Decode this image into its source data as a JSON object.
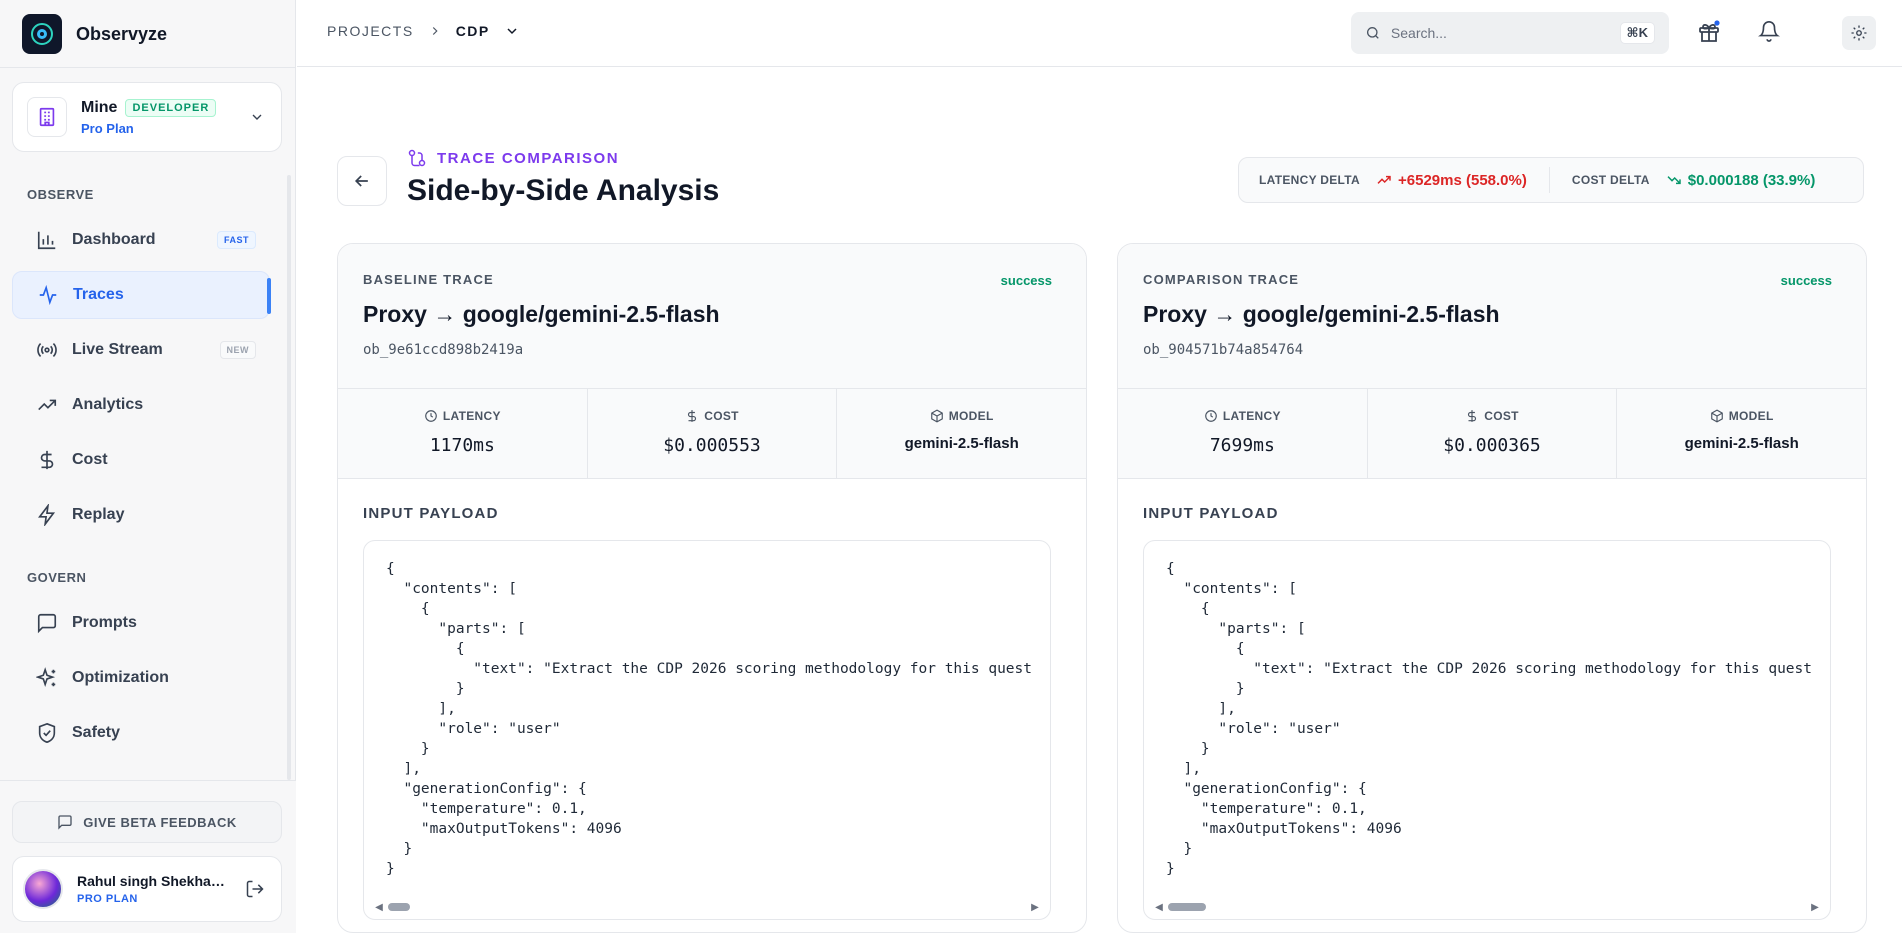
{
  "brand": {
    "name": "Observyze"
  },
  "workspace": {
    "name": "Mine",
    "role": "DEVELOPER",
    "plan": "Pro Plan"
  },
  "nav": {
    "observe_label": "OBSERVE",
    "govern_label": "GOVERN",
    "observe_items": [
      {
        "label": "Dashboard",
        "badge": "FAST",
        "icon": "bar-chart-icon"
      },
      {
        "label": "Traces",
        "badge": "",
        "icon": "activity-icon",
        "active": true
      },
      {
        "label": "Live Stream",
        "badge": "NEW",
        "icon": "radio-icon"
      },
      {
        "label": "Analytics",
        "badge": "",
        "icon": "trending-up-icon"
      },
      {
        "label": "Cost",
        "badge": "",
        "icon": "dollar-icon"
      },
      {
        "label": "Replay",
        "badge": "",
        "icon": "zap-icon"
      }
    ],
    "govern_items": [
      {
        "label": "Prompts",
        "icon": "message-square-icon"
      },
      {
        "label": "Optimization",
        "icon": "sparkles-icon"
      },
      {
        "label": "Safety",
        "icon": "shield-check-icon"
      }
    ]
  },
  "feedback": {
    "label": "GIVE BETA FEEDBACK"
  },
  "user": {
    "name": "Rahul singh Shekhawat",
    "plan": "PRO PLAN"
  },
  "topbar": {
    "breadcrumb_root": "PROJECTS",
    "breadcrumb_current": "CDP",
    "search_placeholder": "Search...",
    "search_shortcut": "⌘K"
  },
  "page": {
    "eyebrow": "TRACE COMPARISON",
    "title": "Side-by-Side Analysis"
  },
  "delta": {
    "latency_label": "LATENCY DELTA",
    "latency_value": "+6529ms (558.0%)",
    "cost_label": "COST DELTA",
    "cost_value": "$0.000188 (33.9%)",
    "latency_color": "#dc2626",
    "cost_color": "#059669"
  },
  "baseline": {
    "kicker": "BASELINE TRACE",
    "status": "success",
    "title": "Proxy → google/gemini-2.5-flash",
    "id": "ob_9e61ccd898b2419a",
    "latency_label": "LATENCY",
    "latency": "1170ms",
    "cost_label": "COST",
    "cost": "$0.000553",
    "model_label": "MODEL",
    "model": "gemini-2.5-flash",
    "payload_label": "INPUT PAYLOAD",
    "payload": "{\n  \"contents\": [\n    {\n      \"parts\": [\n        {\n          \"text\": \"Extract the CDP 2026 scoring methodology for this quest\n        }\n      ],\n      \"role\": \"user\"\n    }\n  ],\n  \"generationConfig\": {\n    \"temperature\": 0.1,\n    \"maxOutputTokens\": 4096\n  }\n}"
  },
  "comparison": {
    "kicker": "COMPARISON TRACE",
    "status": "success",
    "title": "Proxy → google/gemini-2.5-flash",
    "id": "ob_904571b74a854764",
    "latency_label": "LATENCY",
    "latency": "7699ms",
    "cost_label": "COST",
    "cost": "$0.000365",
    "model_label": "MODEL",
    "model": "gemini-2.5-flash",
    "payload_label": "INPUT PAYLOAD",
    "payload": "{\n  \"contents\": [\n    {\n      \"parts\": [\n        {\n          \"text\": \"Extract the CDP 2026 scoring methodology for this quest\n        }\n      ],\n      \"role\": \"user\"\n    }\n  ],\n  \"generationConfig\": {\n    \"temperature\": 0.1,\n    \"maxOutputTokens\": 4096\n  }\n}"
  },
  "colors": {
    "accent": "#2563eb",
    "purple": "#7c3aed",
    "success": "#059669",
    "danger": "#dc2626"
  }
}
